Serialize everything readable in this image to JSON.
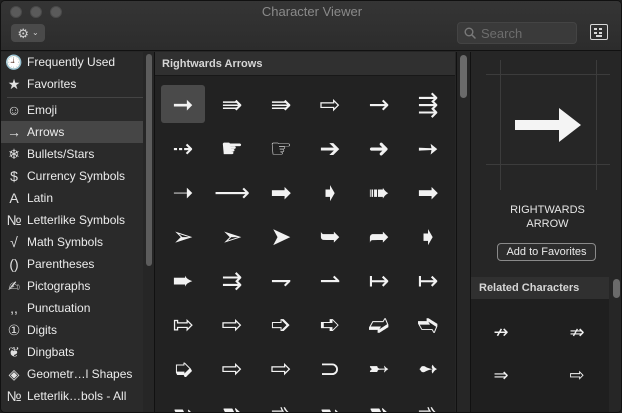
{
  "window": {
    "title": "Character Viewer"
  },
  "toolbar": {
    "gear_icon": "⚙",
    "chevron_icon": "⌄",
    "search_placeholder": "Search",
    "keyboard_icon_name": "keyboard-viewer-icon"
  },
  "sidebar": {
    "items": [
      {
        "icon": "🕘",
        "label": "Frequently Used"
      },
      {
        "icon": "★",
        "label": "Favorites"
      },
      {
        "icon": "☺",
        "label": "Emoji"
      },
      {
        "icon": "→",
        "label": "Arrows",
        "selected": true
      },
      {
        "icon": "❄",
        "label": "Bullets/Stars"
      },
      {
        "icon": "$",
        "label": "Currency Symbols"
      },
      {
        "icon": "A",
        "label": "Latin"
      },
      {
        "icon": "№",
        "label": "Letterlike Symbols"
      },
      {
        "icon": "√",
        "label": "Math Symbols"
      },
      {
        "icon": "()",
        "label": "Parentheses"
      },
      {
        "icon": "✍",
        "label": "Pictographs"
      },
      {
        "icon": ",,",
        "label": "Punctuation"
      },
      {
        "icon": "①",
        "label": "Digits"
      },
      {
        "icon": "❦",
        "label": "Dingbats"
      },
      {
        "icon": "◈",
        "label": "Geometr…l Shapes"
      },
      {
        "icon": "№",
        "label": "Letterlik…bols - All"
      }
    ]
  },
  "grid": {
    "header": "Rightwards Arrows",
    "rows": [
      [
        "➞",
        "⇛",
        "⇛",
        "⇨",
        "→",
        "⇶"
      ],
      [
        "⇢",
        "☛",
        "☞",
        "➔",
        "➜",
        "➙"
      ],
      [
        "➝",
        "⟶",
        "➡",
        "➧",
        "➠",
        "➡"
      ],
      [
        "➢",
        "➣",
        "➤",
        "➥",
        "➦",
        "➧"
      ],
      [
        "➨",
        "⇉",
        "⇁",
        "⇀",
        "↦",
        "↦"
      ],
      [
        "⇰",
        "⇨",
        "➩",
        "➪",
        "➫",
        "➬"
      ],
      [
        "➭",
        "⇨",
        "⇨",
        "⊃",
        "➸",
        "➻"
      ],
      [
        "➼",
        "➽",
        "➾",
        "➼",
        "➽",
        "➾"
      ]
    ]
  },
  "preview": {
    "character": "➡",
    "name_line1": "RIGHTWARDS",
    "name_line2": "ARROW",
    "add_favorites_label": "Add to Favorites"
  },
  "related": {
    "header": "Related Characters",
    "chars": [
      "↛",
      "⇏",
      "⇒",
      "⇨"
    ]
  }
}
